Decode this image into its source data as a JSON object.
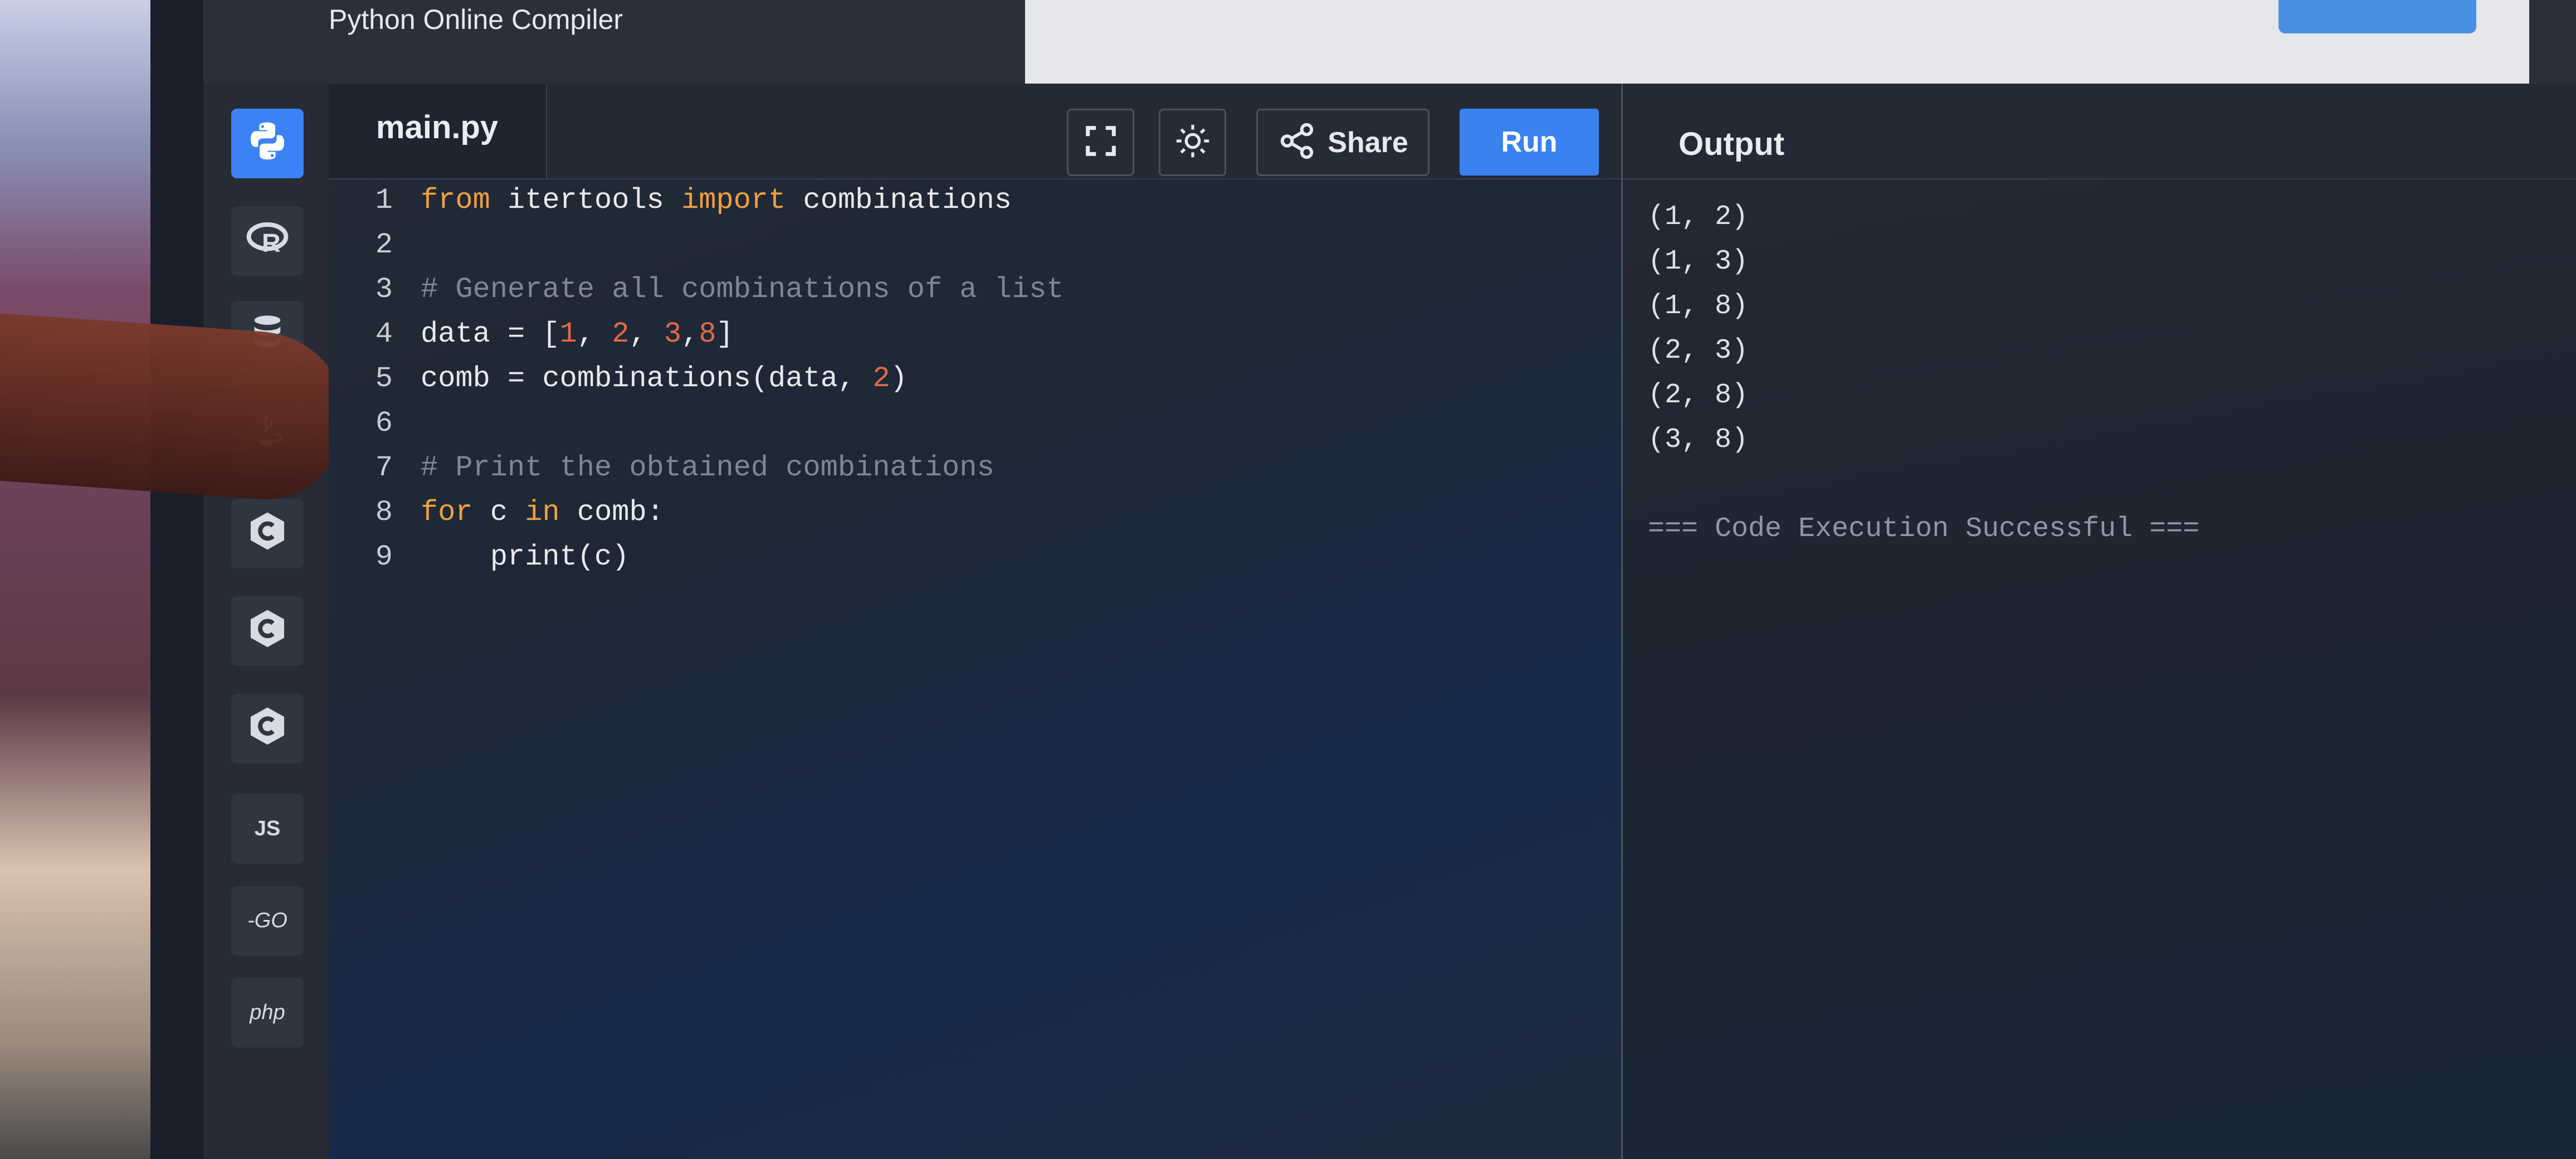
{
  "app": {
    "title": "Python Online Compiler"
  },
  "sidebar": {
    "items": [
      {
        "name": "python",
        "icon": "python-icon",
        "active": true
      },
      {
        "name": "r",
        "icon": "r-icon"
      },
      {
        "name": "sql",
        "icon": "database-icon"
      },
      {
        "name": "java",
        "icon": "java-icon"
      },
      {
        "name": "c",
        "icon": "c-icon"
      },
      {
        "name": "cpp",
        "icon": "cpp-icon"
      },
      {
        "name": "csharp",
        "icon": "csharp-icon"
      },
      {
        "name": "js",
        "label": "JS"
      },
      {
        "name": "go",
        "label": "-GO"
      },
      {
        "name": "php",
        "label": "php"
      }
    ]
  },
  "editor": {
    "file_name": "main.py",
    "toolbar": {
      "fullscreen_icon": "fullscreen-icon",
      "theme_icon": "sun-icon",
      "share_label": "Share",
      "run_label": "Run"
    },
    "lines": [
      {
        "n": "1",
        "tokens": [
          {
            "t": "from",
            "c": "kw"
          },
          {
            "t": " itertools "
          },
          {
            "t": "import",
            "c": "kw"
          },
          {
            "t": " combinations"
          }
        ]
      },
      {
        "n": "2",
        "tokens": []
      },
      {
        "n": "3",
        "tokens": [
          {
            "t": "# Generate all combinations of a list",
            "c": "cm"
          }
        ]
      },
      {
        "n": "4",
        "tokens": [
          {
            "t": "data = ["
          },
          {
            "t": "1",
            "c": "num"
          },
          {
            "t": ", "
          },
          {
            "t": "2",
            "c": "num"
          },
          {
            "t": ", "
          },
          {
            "t": "3",
            "c": "num"
          },
          {
            "t": ","
          },
          {
            "t": "8",
            "c": "num"
          },
          {
            "t": "]"
          }
        ]
      },
      {
        "n": "5",
        "tokens": [
          {
            "t": "comb = combinations(data, "
          },
          {
            "t": "2",
            "c": "num"
          },
          {
            "t": ")"
          }
        ]
      },
      {
        "n": "6",
        "tokens": []
      },
      {
        "n": "7",
        "tokens": [
          {
            "t": "# Print the obtained combinations",
            "c": "cm"
          }
        ]
      },
      {
        "n": "8",
        "tokens": [
          {
            "t": "for",
            "c": "kw"
          },
          {
            "t": " c "
          },
          {
            "t": "in",
            "c": "kw"
          },
          {
            "t": " comb:"
          }
        ]
      },
      {
        "n": "9",
        "tokens": [
          {
            "t": "    print(c)"
          }
        ]
      }
    ]
  },
  "output": {
    "title": "Output",
    "lines": [
      "(1, 2)",
      "(1, 3)",
      "(1, 8)",
      "(2, 3)",
      "(2, 8)",
      "(3, 8)"
    ],
    "status": "=== Code Execution Successful ==="
  }
}
